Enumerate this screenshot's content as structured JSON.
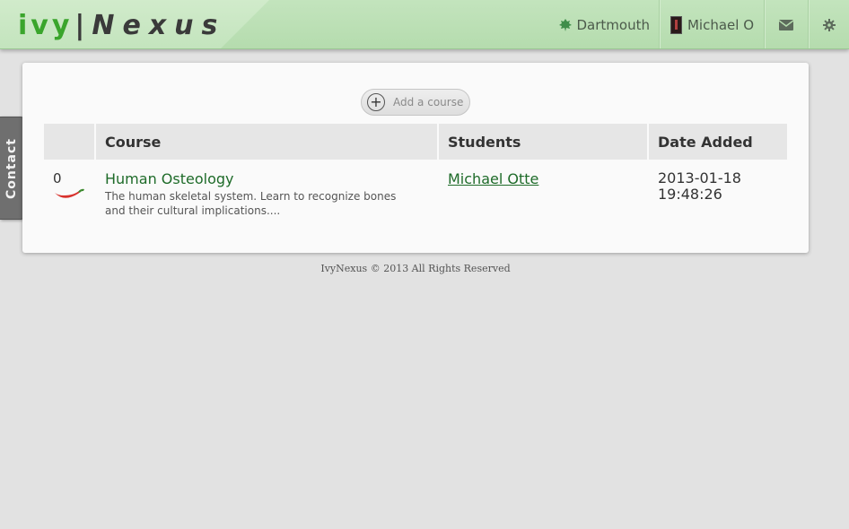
{
  "header": {
    "logo_ivy": "ivy",
    "logo_bar": "|",
    "logo_nexus": "Nexus",
    "school": "Dartmouth",
    "user": "Michael O"
  },
  "contact_tab": "Contact",
  "add_course_label": "Add a course",
  "table": {
    "columns": [
      "",
      "Course",
      "Students",
      "Date Added"
    ],
    "rows": [
      {
        "rating": "0",
        "title": "Human Osteology",
        "description": "The human skeletal system. Learn to recognize bones and their cultural implications....",
        "student": "Michael Otte",
        "date": "2013-01-18",
        "time": "19:48:26"
      }
    ]
  },
  "footer": "IvyNexus © 2013 All Rights Reserved",
  "colors": {
    "header_green": "#b5dcae",
    "logo_green": "#3aa52c",
    "link_green": "#1e6b29"
  },
  "icons": [
    "leaf-icon",
    "avatar",
    "mail-icon",
    "gear-icon",
    "plus-circle-icon",
    "chili-pepper-icon"
  ]
}
